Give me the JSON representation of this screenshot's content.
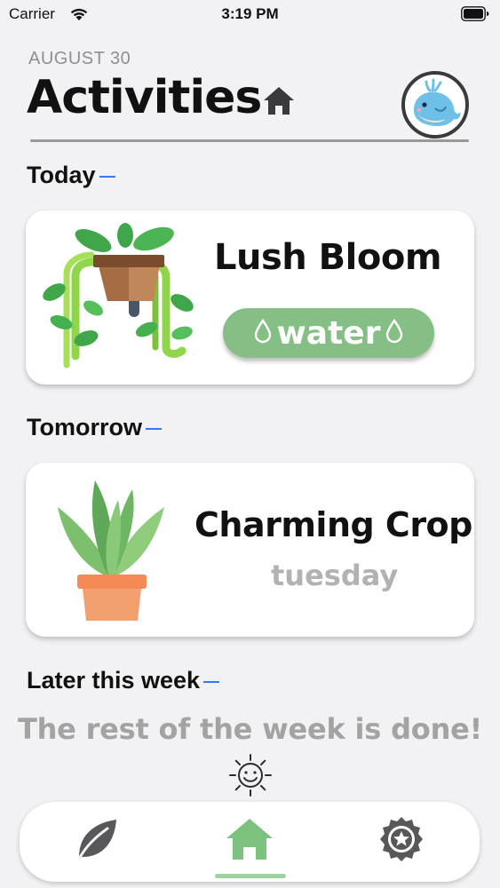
{
  "status_bar": {
    "carrier": "Carrier",
    "time": "3:19 PM",
    "icons": [
      "wifi-icon",
      "battery-icon"
    ]
  },
  "header": {
    "date": "AUGUST 30",
    "title": "Activities",
    "title_icon": "home-icon",
    "avatar": "whale-avatar"
  },
  "sections": [
    {
      "heading": "Today",
      "card": {
        "plant_name": "Lush Bloom",
        "action_label": "water",
        "action_icon": "water-drop-icon",
        "image": "hanging-plant"
      }
    },
    {
      "heading": "Tomorrow",
      "card": {
        "plant_name": "Charming Crop",
        "day": "tuesday",
        "image": "potted-plant"
      }
    },
    {
      "heading": "Later this week",
      "message": "The rest of the week is done!",
      "icon": "smiling-sun-icon"
    }
  ],
  "tab_bar": {
    "tabs": [
      {
        "icon": "leaf-icon",
        "selected": false
      },
      {
        "icon": "home-icon",
        "selected": true
      },
      {
        "icon": "star-badge-icon",
        "selected": false
      }
    ]
  },
  "colors": {
    "accent_green": "#86bf86",
    "tab_green": "#7cc17e",
    "section_dash": "#3478f6",
    "muted_text": "#a3a3a3"
  }
}
